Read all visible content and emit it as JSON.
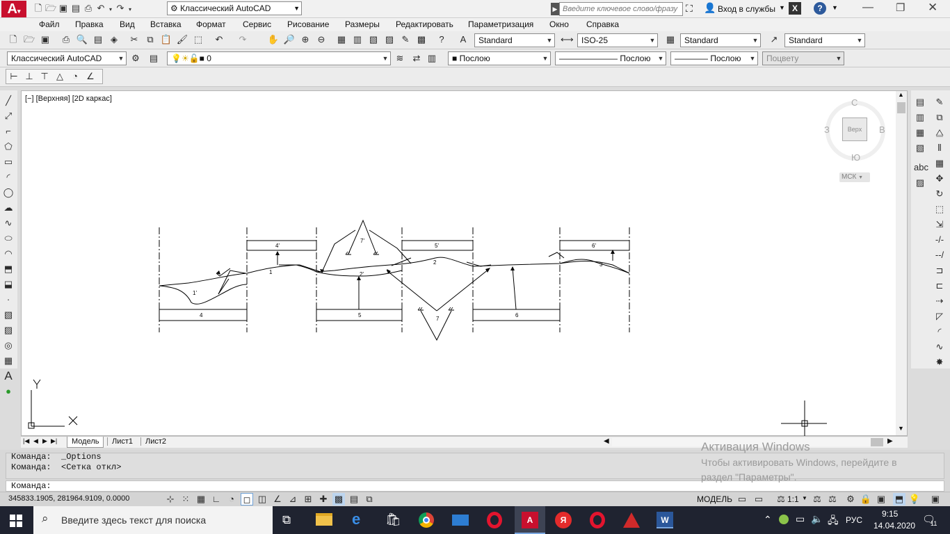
{
  "app": {
    "workspace": "Классический AutoCAD",
    "search_placeholder": "Введите ключевое слово/фразу",
    "signin": "Вход в службы"
  },
  "menu": [
    "Файл",
    "Правка",
    "Вид",
    "Вставка",
    "Формат",
    "Сервис",
    "Рисование",
    "Размеры",
    "Редактировать",
    "Параметризация",
    "Окно",
    "Справка"
  ],
  "styles": {
    "text_style": "Standard",
    "dim_style": "ISO-25",
    "table_style": "Standard",
    "mleader_style": "Standard"
  },
  "layers": {
    "workspace": "Классический AutoCAD",
    "layer_name": "0",
    "color": "Послою",
    "linetype": "Послою",
    "lineweight": "Послою",
    "plotstyle": "Поцвету"
  },
  "viewport": {
    "label": "[−] [Верхняя] [2D каркас]",
    "viewcube_top": "Верх",
    "north": "С",
    "south": "Ю",
    "west": "З",
    "east": "В",
    "ucs": "МСК"
  },
  "drawing_labels": {
    "upper": [
      "4'",
      "5'",
      "6'"
    ],
    "lower": [
      "4",
      "5",
      "6"
    ],
    "tri_top": "7'",
    "tri_bottom": "7",
    "curve": [
      "1",
      "1'",
      "2",
      "2'",
      "3"
    ]
  },
  "tabs": [
    "Модель",
    "Лист1",
    "Лист2"
  ],
  "command": {
    "line1": "Команда:  _Options",
    "line2": "Команда:  <Сетка откл>",
    "prompt": "Команда:"
  },
  "watermark": {
    "title": "Активация Windows",
    "line1": "Чтобы активировать Windows, перейдите в",
    "line2": "раздел \"Параметры\"."
  },
  "status": {
    "coords": "345833.1905, 281964.9109, 0.0000",
    "model": "МОДЕЛЬ",
    "scale": "1:1"
  },
  "taskbar": {
    "search": "Введите здесь текст для поиска",
    "lang": "РУС",
    "time": "9:15",
    "date": "14.04.2020",
    "notif": "11"
  },
  "colors": {
    "autocad_red": "#c8102e",
    "taskbar": "#1f2330"
  }
}
